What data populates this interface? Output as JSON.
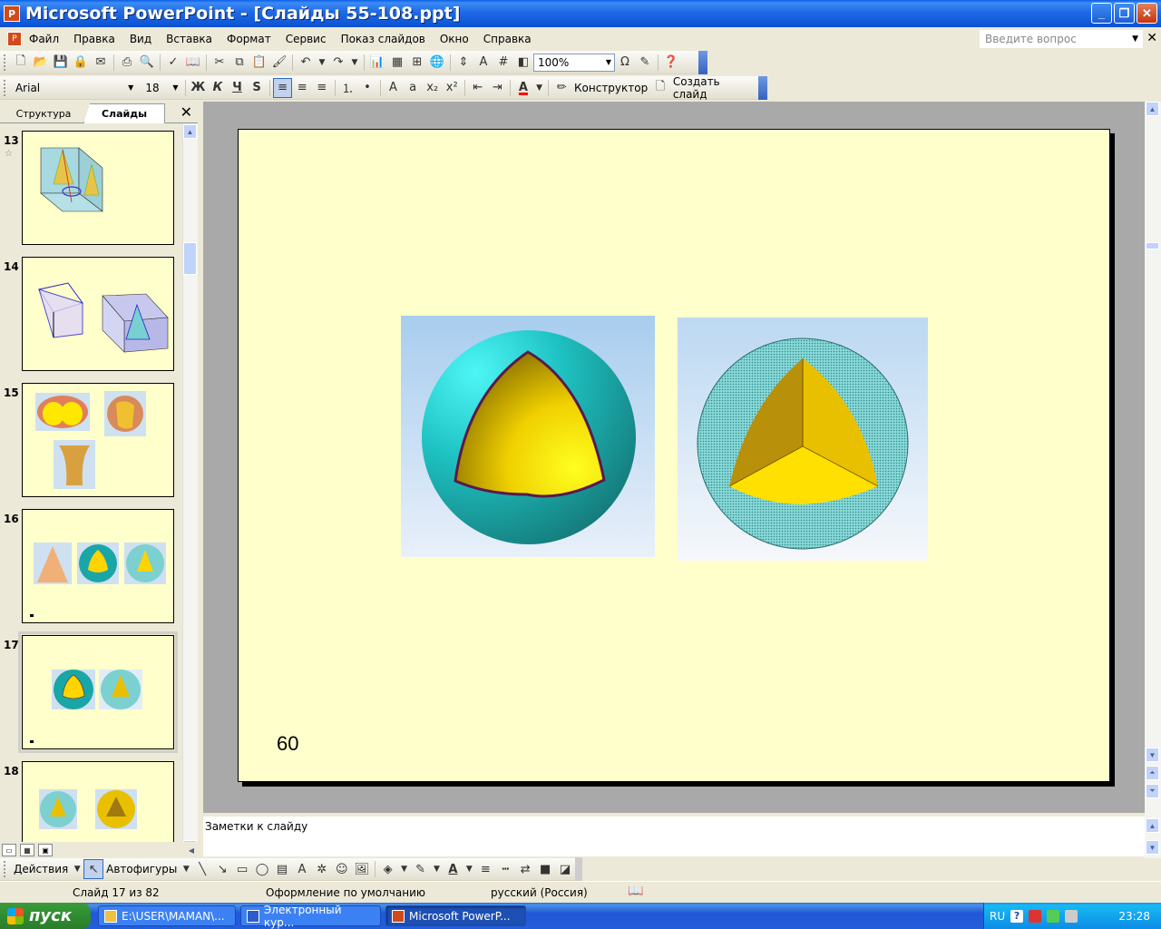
{
  "window": {
    "title": "Microsoft PowerPoint - [Слайды 55-108.ppt]"
  },
  "menu": {
    "items": [
      "Файл",
      "Правка",
      "Вид",
      "Вставка",
      "Формат",
      "Сервис",
      "Показ слайдов",
      "Окно",
      "Справка"
    ],
    "ask_placeholder": "Введите вопрос"
  },
  "toolbar_standard": {
    "zoom": "100%"
  },
  "toolbar_format": {
    "font": "Arial",
    "size": "18",
    "bold": "Ж",
    "italic": "К",
    "underline": "Ч",
    "shadow": "S",
    "designer": "Конструктор",
    "new_slide": "Создать слайд"
  },
  "left_pane": {
    "tab_outline": "Структура",
    "tab_slides": "Слайды",
    "thumbnails": [
      {
        "number": "13"
      },
      {
        "number": "14"
      },
      {
        "number": "15"
      },
      {
        "number": "16"
      },
      {
        "number": "17"
      },
      {
        "number": "18"
      }
    ]
  },
  "slide": {
    "page_number": "60"
  },
  "notes": {
    "placeholder": "Заметки к слайду"
  },
  "draw_toolbar": {
    "actions": "Действия",
    "autoshapes": "Автофигуры"
  },
  "status": {
    "slide": "Слайд 17 из 82",
    "design": "Оформление по умолчанию",
    "language": "русский (Россия)"
  },
  "taskbar": {
    "start": "пуск",
    "tasks": [
      "E:\\USER\\MAMAN\\...",
      "Электронный кур...",
      "Microsoft PowerP..."
    ],
    "lang": "RU",
    "clock": "23:28"
  },
  "colors": {
    "slide_background": "#ffffcc",
    "sphere_teal": "#1aa6a6",
    "octant_yellow": "#ffd700"
  }
}
